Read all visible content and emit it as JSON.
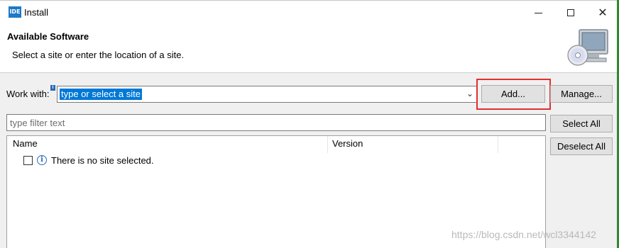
{
  "window": {
    "app_icon_text": "IDE",
    "title": "Install",
    "minimize_icon": "minimize-icon",
    "maximize_icon": "maximize-icon",
    "close_icon": "close-icon",
    "close_glyph": "✕"
  },
  "header": {
    "title": "Available Software",
    "description": "Select a site or enter the location of a site.",
    "banner_icon": "install-cd-monitor-icon"
  },
  "work_with": {
    "label": "Work with:",
    "info_marker": "i",
    "value": "type or select a site",
    "dropdown_icon": "chevron-down-icon",
    "dropdown_glyph": "⌄"
  },
  "buttons": {
    "add": "Add...",
    "manage": "Manage...",
    "select_all": "Select All",
    "deselect_all": "Deselect All"
  },
  "filter": {
    "placeholder": "type filter text"
  },
  "table": {
    "columns": [
      "Name",
      "Version"
    ],
    "rows": [
      {
        "checked": false,
        "icon": "info-icon",
        "icon_glyph": "i",
        "name": "There is no site selected."
      }
    ]
  },
  "highlight": {
    "target": "add-button",
    "color": "#e03030"
  },
  "watermark": "https://blog.csdn.net/wcl3344142",
  "colors": {
    "selection": "#0078d7",
    "accent_edge": "#2d8a2d"
  }
}
